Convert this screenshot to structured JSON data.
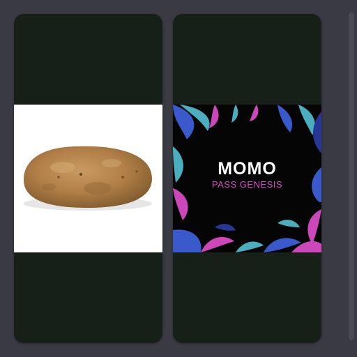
{
  "cards": [
    {
      "image": {
        "subject": "potato",
        "background_color": "#ffffff"
      }
    },
    {
      "image": {
        "background_color": "#050505",
        "title": "MOMO",
        "subtitle": "PASS GENESIS",
        "title_color": "#ffffff",
        "subtitle_color": "#d64bc4",
        "foliage_colors": [
          "#3d5fd6",
          "#d64bc4",
          "#4fb8c9",
          "#2a3a9e"
        ]
      }
    }
  ],
  "colors": {
    "page_background": "#3a3a43",
    "card_background": "#162019"
  }
}
